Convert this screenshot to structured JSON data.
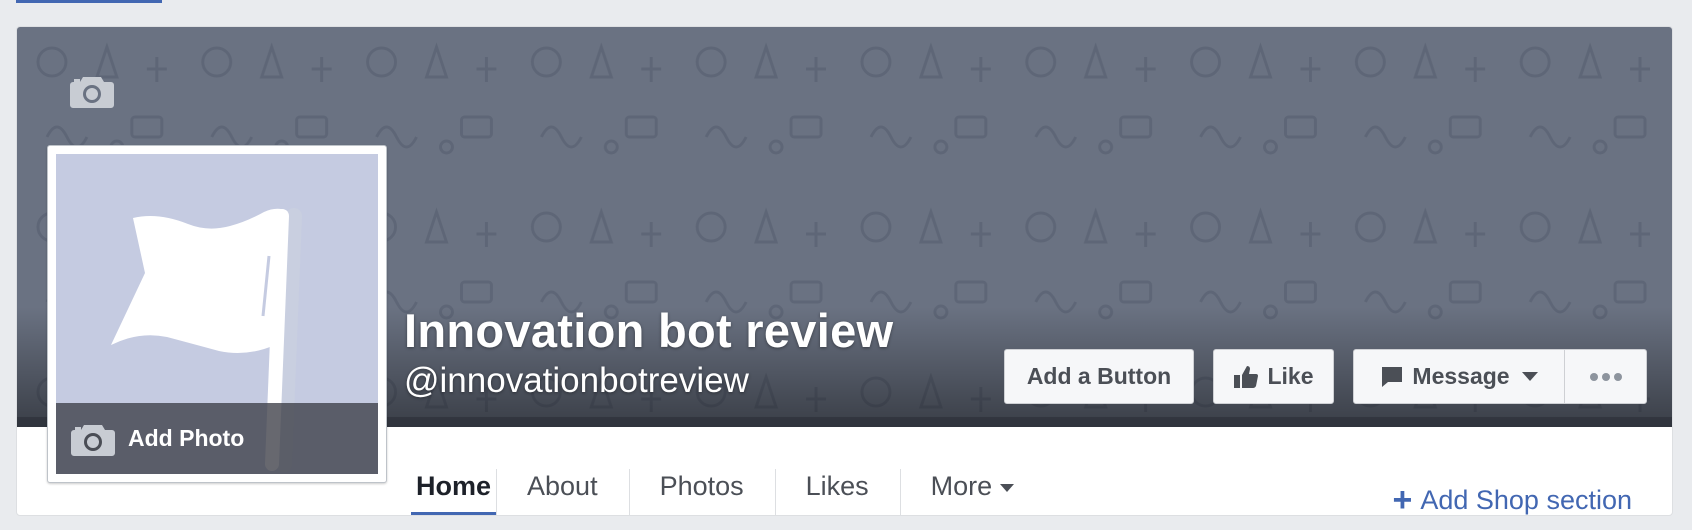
{
  "page": {
    "name": "Innovation bot review",
    "handle": "@innovationbotreview"
  },
  "profile": {
    "add_photo_label": "Add Photo"
  },
  "actions": {
    "add_button_label": "Add a Button",
    "like_label": "Like",
    "message_label": "Message"
  },
  "tabs": [
    {
      "label": "Home",
      "active": true
    },
    {
      "label": "About"
    },
    {
      "label": "Photos"
    },
    {
      "label": "Likes"
    },
    {
      "label": "More"
    }
  ],
  "shop": {
    "add_label": "Add Shop section"
  },
  "colors": {
    "accent": "#4267b2",
    "cover": "#6a7282",
    "profile_bg": "#c5cbe1"
  },
  "icons": {
    "cover_camera": "camera-icon",
    "profile_camera": "camera-icon",
    "like": "thumbs-up-icon",
    "message": "speech-bubble-icon",
    "more": "ellipsis-icon",
    "flag": "flag-icon"
  }
}
